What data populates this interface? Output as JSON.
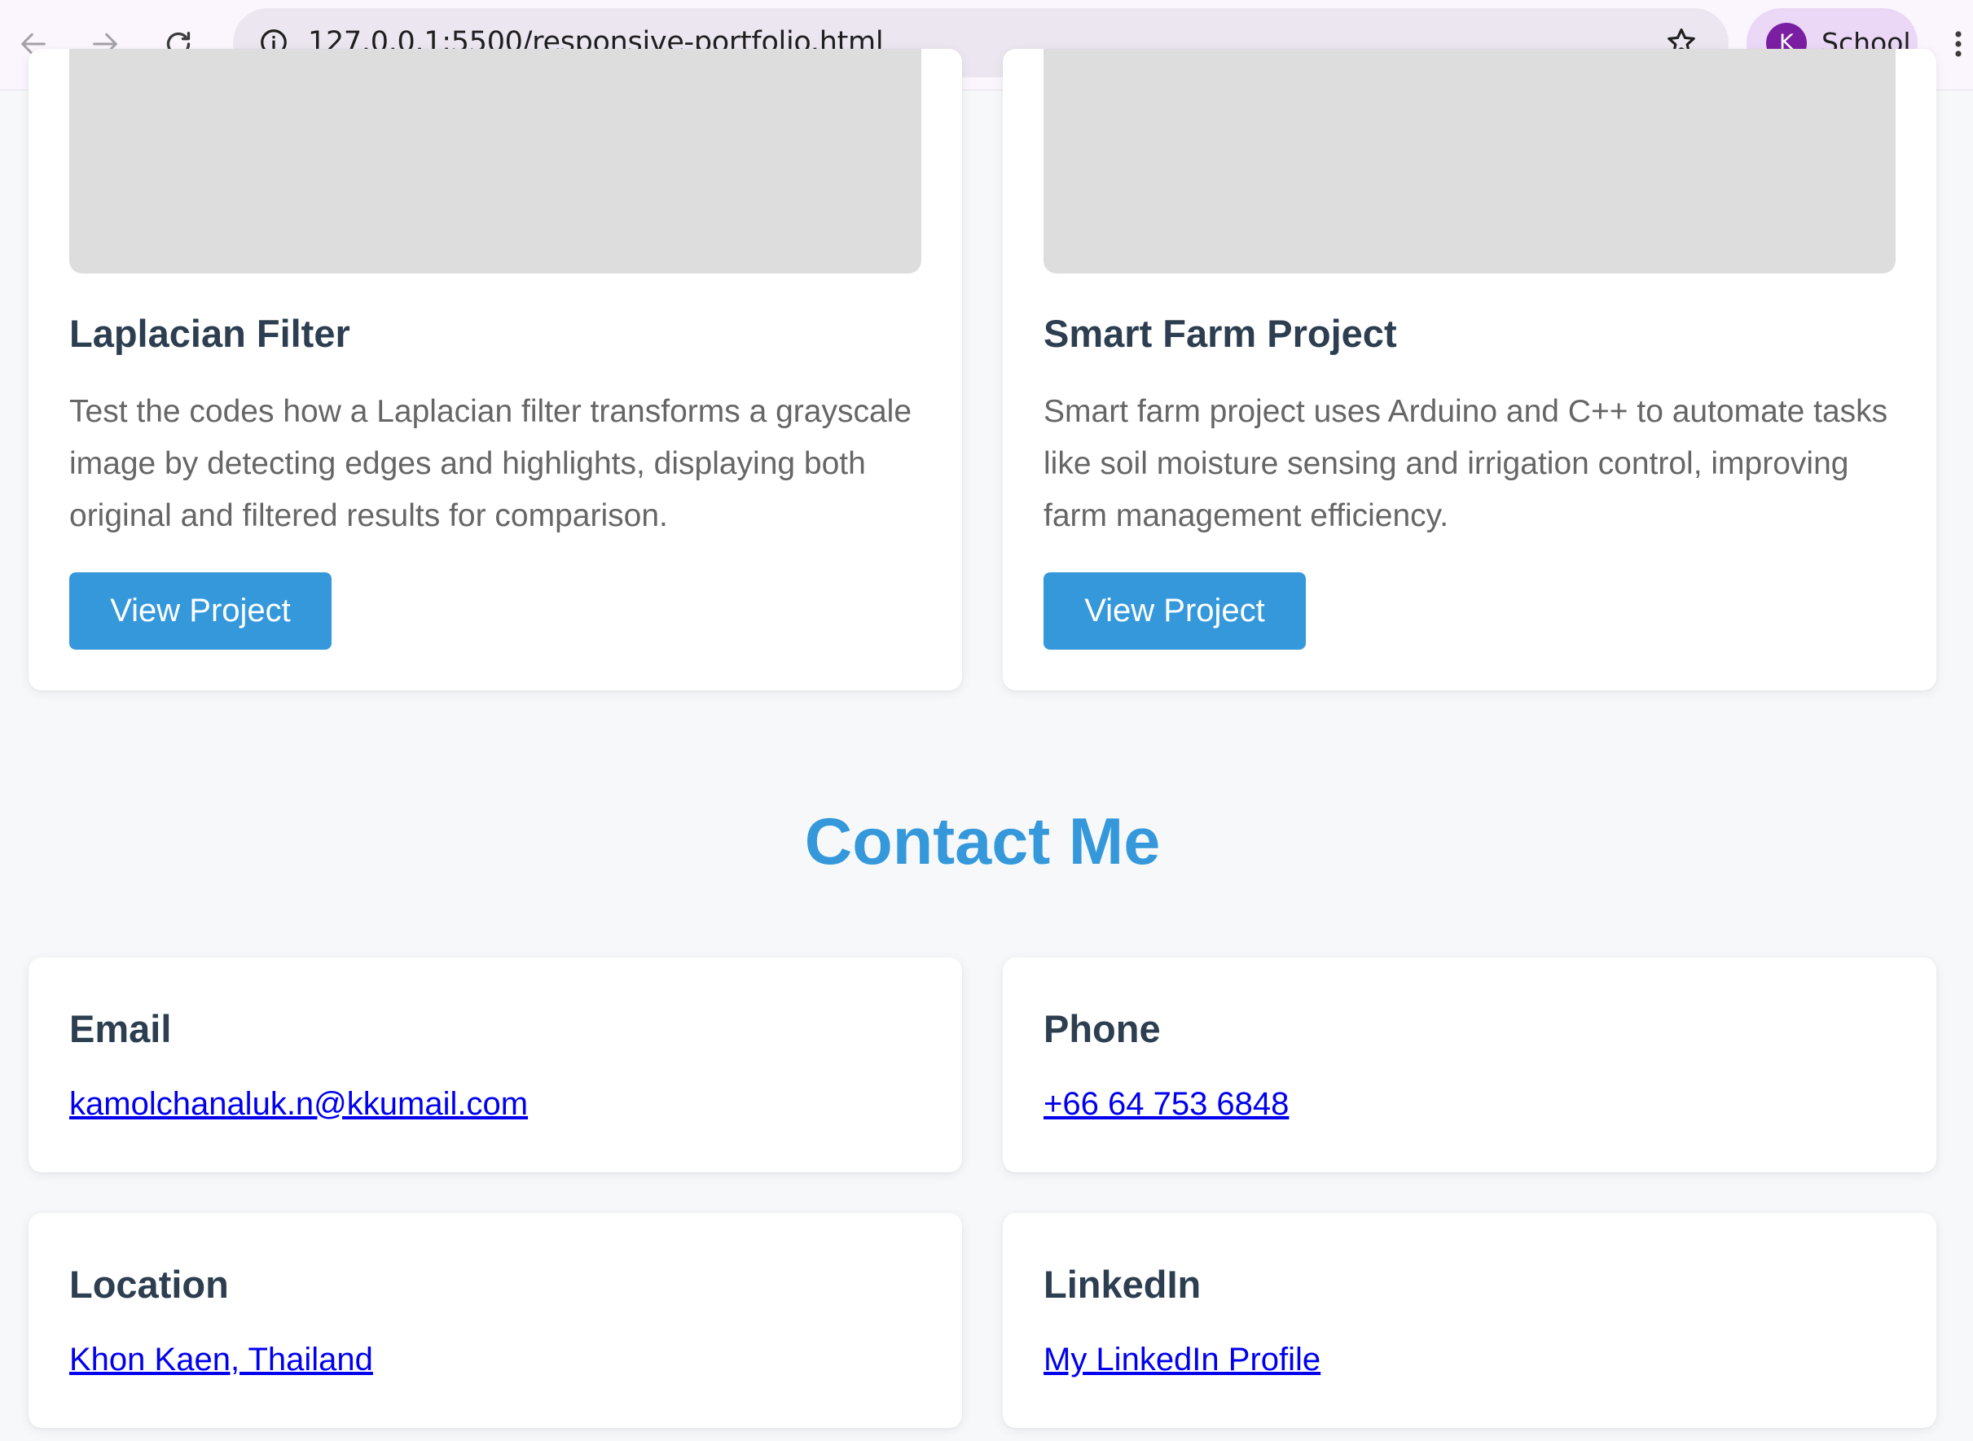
{
  "browser": {
    "url": "127.0.0.1:5500/responsive-portfolio.html",
    "profile_initial": "K",
    "profile_name": "School",
    "colors": {
      "toolbar_bg": "#fbf6fd",
      "omnibox_bg": "#ece6f0",
      "profile_chip_bg": "#ead8f6",
      "avatar_bg": "#7b1fa2"
    },
    "icons": [
      "back-arrow-icon",
      "forward-arrow-icon",
      "reload-icon",
      "site-info-icon",
      "bookmark-star-icon",
      "more-vert-icon"
    ]
  },
  "projects": [
    {
      "title": "Laplacian Filter",
      "description": "Test the codes how a Laplacian filter transforms a grayscale image by detecting edges and highlights, displaying both original and filtered results for comparison.",
      "button_label": "View Project"
    },
    {
      "title": "Smart Farm Project",
      "description": "Smart farm project uses Arduino and C++ to automate tasks like soil moisture sensing and irrigation control, improving farm management efficiency.",
      "button_label": "View Project"
    }
  ],
  "contact": {
    "heading": "Contact Me",
    "items": [
      {
        "label": "Email",
        "value": "kamolchanaluk.n@kkumail.com"
      },
      {
        "label": "Phone",
        "value": "+66 64 753 6848"
      },
      {
        "label": "Location",
        "value": "Khon Kaen, Thailand"
      },
      {
        "label": "LinkedIn",
        "value": "My LinkedIn Profile"
      }
    ]
  },
  "theme": {
    "accent": "#3498db",
    "heading_text": "#2c3e50",
    "body_text": "#666666",
    "link": "#0000ee",
    "page_bg": "#f7f8fa",
    "image_placeholder": "#dddddd"
  }
}
